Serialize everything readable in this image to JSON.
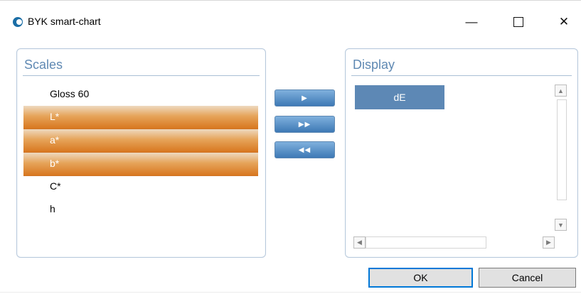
{
  "window": {
    "title": "BYK smart-chart",
    "controls": {
      "minimize": "—",
      "close": "✕"
    }
  },
  "scales": {
    "title": "Scales",
    "items": [
      {
        "label": "Gloss 60",
        "selected": false
      },
      {
        "label": "L*",
        "selected": true
      },
      {
        "label": "a*",
        "selected": true
      },
      {
        "label": "b*",
        "selected": true
      },
      {
        "label": "C*",
        "selected": false
      },
      {
        "label": "h",
        "selected": false
      }
    ]
  },
  "display": {
    "title": "Display",
    "items": [
      {
        "label": "dE",
        "selected": true
      }
    ]
  },
  "transfer_buttons": {
    "move_one": "▶",
    "move_all": "▶▶",
    "remove_all": "◀◀"
  },
  "scrollbars": {
    "up": "▲",
    "down": "▼",
    "left": "◀",
    "right": "▶"
  },
  "actions": {
    "ok": "OK",
    "cancel": "Cancel"
  },
  "colors": {
    "panel_title": "#5f89b3",
    "selection_orange": "#d8771f",
    "display_item": "#5d88b5",
    "button_blue": "#3e79b5"
  }
}
